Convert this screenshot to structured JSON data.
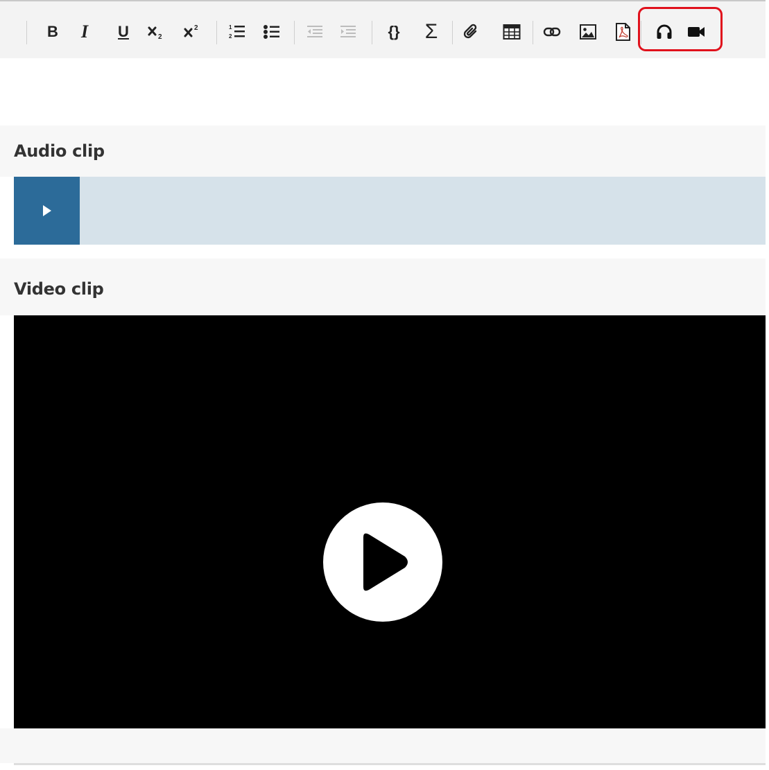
{
  "toolbar": {
    "buttons": [
      {
        "name": "bold",
        "label": "B",
        "icon": "bold-icon"
      },
      {
        "name": "italic",
        "label": "I",
        "icon": "italic-icon"
      },
      {
        "name": "underline",
        "label": "U",
        "icon": "underline-icon"
      },
      {
        "name": "subscript",
        "icon": "subscript-icon"
      },
      {
        "name": "superscript",
        "icon": "superscript-icon"
      },
      {
        "name": "numbered-list",
        "icon": "numbered-list-icon"
      },
      {
        "name": "bulleted-list",
        "icon": "bulleted-list-icon"
      },
      {
        "name": "decrease-indent",
        "icon": "outdent-icon",
        "disabled": true
      },
      {
        "name": "increase-indent",
        "icon": "indent-icon",
        "disabled": true
      },
      {
        "name": "code",
        "label": "{}",
        "icon": "code-braces-icon"
      },
      {
        "name": "math",
        "label": "Σ",
        "icon": "sigma-icon"
      },
      {
        "name": "attach",
        "icon": "paperclip-icon"
      },
      {
        "name": "table",
        "icon": "table-icon"
      },
      {
        "name": "link",
        "icon": "link-icon"
      },
      {
        "name": "image",
        "icon": "image-icon"
      },
      {
        "name": "pdf",
        "icon": "pdf-icon"
      },
      {
        "name": "audio",
        "icon": "headphones-icon",
        "highlighted": true
      },
      {
        "name": "video",
        "icon": "video-camera-icon",
        "highlighted": true
      }
    ],
    "highlight_color": "#e0111c"
  },
  "content": {
    "audio_label": "Audio clip",
    "video_label": "Video clip"
  },
  "colors": {
    "audio_play_bg": "#2c6b99",
    "audio_track_bg": "#d6e2ea",
    "video_bg": "#000000"
  }
}
